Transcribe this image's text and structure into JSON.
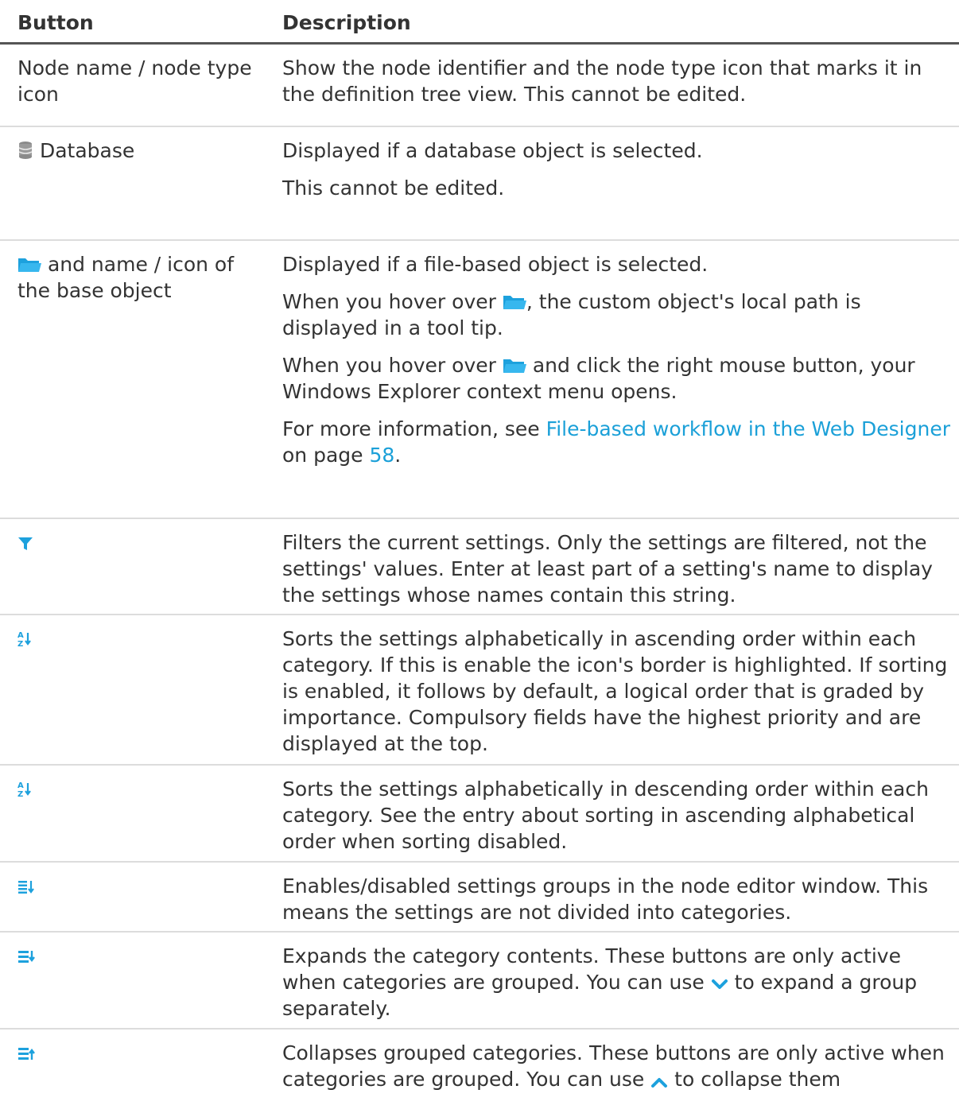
{
  "header": {
    "col1": "Button",
    "col2": "Description"
  },
  "rows": [
    {
      "label": "Node name / node type icon",
      "p1": "Show the node identifier and the node type icon that marks it in the definition tree view. This cannot be edited."
    },
    {
      "label": "Database",
      "icon": "database-icon",
      "p1": "Displayed if a database object is selected.",
      "p2": "This cannot be edited."
    },
    {
      "label": "and name / icon of the base object",
      "icon": "folder-icon",
      "p1": "Displayed if a file-based object is selected.",
      "p2a": "When you hover over",
      "p2b": ", the custom object's local path is displayed in a tool tip.",
      "p3a": "When you hover over",
      "p3b": "and click the right mouse button, your Windows Explorer context menu opens.",
      "p4a": "For more information, see",
      "p4link": "File-based workflow in the Web Designer",
      "p4b": "on page",
      "p4page": "58",
      "p4c": "."
    },
    {
      "icon": "filter-icon",
      "p1": "Filters the current settings. Only the settings are filtered, not the settings' values. Enter at least part of a setting's name to display the settings whose names contain this string."
    },
    {
      "icon": "sort-ascending-icon",
      "p1": "Sorts the settings alphabetically in ascending order within each category. If this is enable the icon's border is highlighted. If sorting is enabled, it follows by default, a logical order that is graded by importance. Compulsory fields have the highest priority and are displayed at the top."
    },
    {
      "icon": "sort-descending-icon",
      "p1": "Sorts the settings alphabetically in descending order within each category. See the entry about sorting in ascending alphabetical order when sorting disabled."
    },
    {
      "icon": "group-settings-icon",
      "p1": "Enables/disabled settings groups in the node editor window. This means the settings are not divided into categories."
    },
    {
      "icon": "expand-all-icon",
      "p1a": "Expands the category contents. These buttons are only active when categories are grouped. You can use",
      "p1b": "to expand a group separately."
    },
    {
      "icon": "collapse-all-icon",
      "p1a": "Collapses grouped categories. These buttons are only active when categories are grouped. You can use",
      "p1b": "to collapse them"
    }
  ],
  "colors": {
    "accent": "#1ba0d8",
    "text": "#333333",
    "rule": "#dcdcdc"
  }
}
